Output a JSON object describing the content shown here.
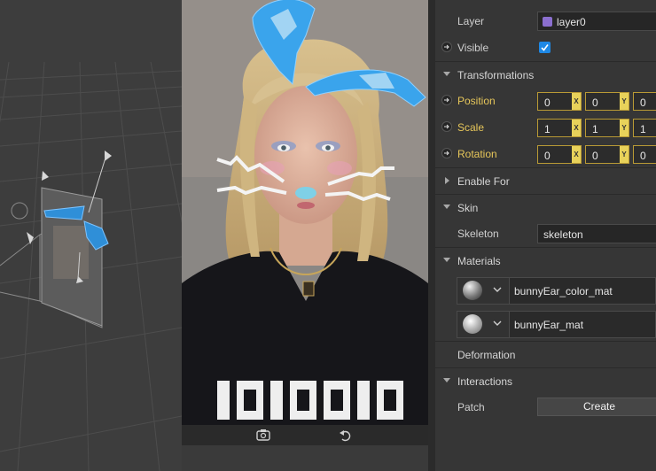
{
  "inspector": {
    "layer": {
      "label": "Layer",
      "value": "layer0",
      "swatch_color": "#8b6fcf"
    },
    "visible": {
      "label": "Visible",
      "checked": true
    },
    "transformations": {
      "label": "Transformations",
      "position": {
        "label": "Position",
        "x": "0",
        "y": "0",
        "z": "0"
      },
      "scale": {
        "label": "Scale",
        "x": "1",
        "y": "1",
        "z": "1"
      },
      "rotation": {
        "label": "Rotation",
        "x": "0",
        "y": "0",
        "z": "0"
      },
      "axis_x": "X",
      "axis_y": "Y"
    },
    "enable_for": {
      "label": "Enable For"
    },
    "skin": {
      "label": "Skin",
      "skeleton_label": "Skeleton",
      "skeleton_value": "skeleton"
    },
    "materials": {
      "label": "Materials",
      "items": [
        {
          "name": "bunnyEar_color_mat"
        },
        {
          "name": "bunnyEar_mat"
        }
      ]
    },
    "deformation": {
      "label": "Deformation"
    },
    "interactions": {
      "label": "Interactions",
      "patch_label": "Patch",
      "create_label": "Create"
    }
  },
  "colors": {
    "accent": "#e6c65a",
    "checkbox": "#1e88e5",
    "panel": "#363636"
  },
  "icons": [
    "arrow-right-icon",
    "collapse-triangle-icon",
    "checkmark-icon",
    "flip-camera-icon",
    "restart-icon",
    "chevron-down-icon"
  ]
}
